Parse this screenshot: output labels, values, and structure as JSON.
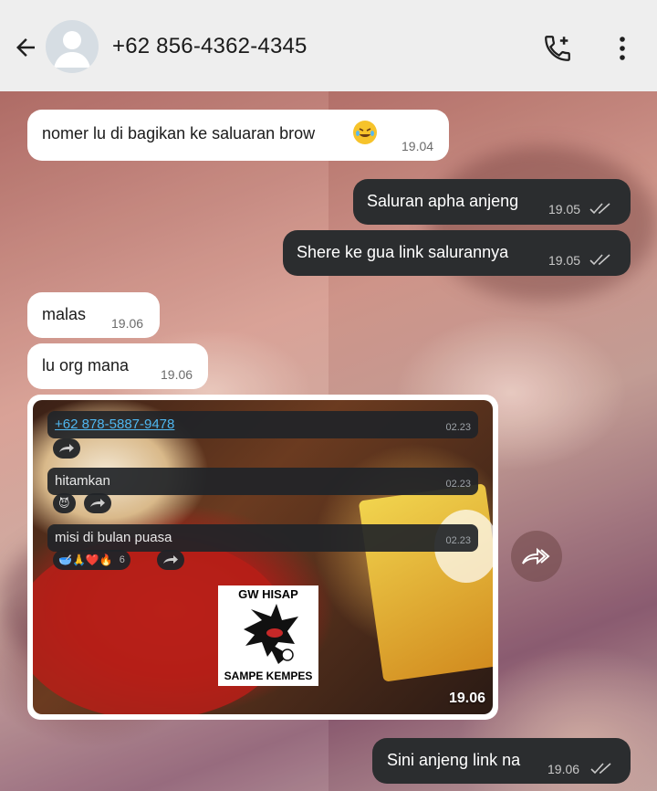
{
  "header": {
    "contact": "+62 856-4362-4345",
    "icons": [
      "back-arrow-icon",
      "avatar-icon",
      "add-call-icon",
      "more-vert-icon"
    ]
  },
  "messages": [
    {
      "direction": "in",
      "text": "nomer lu di bagikan ke saluaran brow",
      "emoji": "rofl-emoji",
      "time": "19.04"
    },
    {
      "direction": "out",
      "text": "Saluran apha anjeng",
      "time": "19.05",
      "status": "read-ticks"
    },
    {
      "direction": "out",
      "text": "Shere ke gua link salurannya",
      "time": "19.05",
      "status": "read-ticks"
    },
    {
      "direction": "in",
      "text": "malas",
      "time": "19.06"
    },
    {
      "direction": "in",
      "text": "lu org mana",
      "time": "19.06"
    },
    {
      "direction": "in",
      "type": "image",
      "time": "19.06",
      "embedded": {
        "msg1": {
          "text": "+62 878-5887-9478",
          "time": "02.23"
        },
        "msg2": {
          "text": "hitamkan",
          "time": "02.23",
          "reaction": "😈"
        },
        "msg3": {
          "text": "misi di bulan puasa",
          "time": "02.23",
          "reactions": "🥣🙏❤️🔥",
          "reaction_count": "6"
        },
        "sticker": {
          "top": "GW HISAP",
          "bottom": "SAMPE KEMPES"
        }
      }
    },
    {
      "direction": "out",
      "text": "Sini anjeng link na",
      "time": "19.06",
      "status": "read-ticks"
    }
  ],
  "colors": {
    "header_bg": "#eeeeee",
    "incoming_bubble": "#ffffff",
    "outgoing_bubble": "#2b2d2f",
    "link": "#4fb7f0"
  }
}
